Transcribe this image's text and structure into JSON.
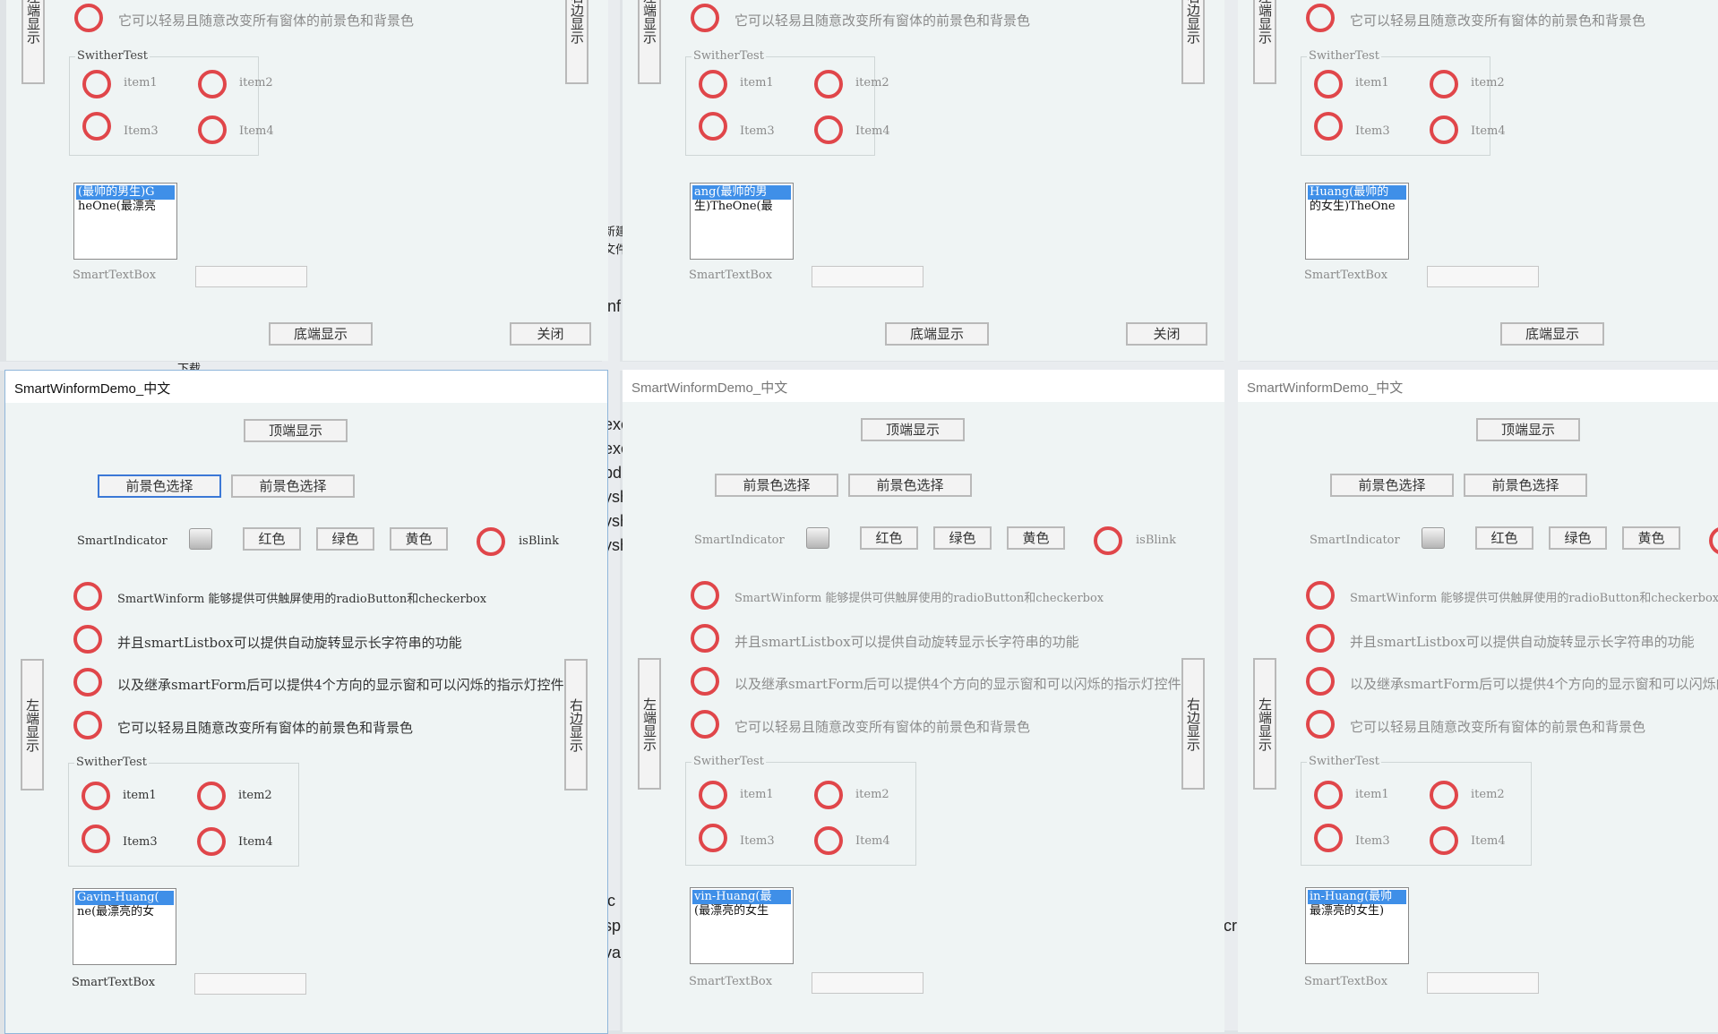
{
  "window": {
    "title": "SmartWinformDemo_中文"
  },
  "buttons": {
    "top": "顶端显示",
    "bottom": "底端显示",
    "close": "关闭",
    "left": "左端显示",
    "right": "右边显示",
    "fore_color_1": "前景色选择",
    "fore_color_2": "前景色选择",
    "red": "红色",
    "green": "绿色",
    "yellow": "黄色"
  },
  "indicator": {
    "label": "SmartIndicator",
    "blink_label": "isBlink"
  },
  "options": [
    "SmartWinform 能够提供可供触屏使用的radioButton和checkerbox",
    "并且smartListbox可以提供自动旋转显示长字符串的功能",
    "以及继承smartForm后可以提供4个方向的显示窗和可以闪烁的指示灯控件",
    "它可以轻易且随意改变所有窗体的前景色和背景色"
  ],
  "switcher": {
    "title": "SwitherTest",
    "items": [
      "item1",
      "item2",
      "Item3",
      "Item4"
    ]
  },
  "textbox": {
    "label": "SmartTextBox"
  },
  "listboxes": {
    "top_left": [
      "(最帅的男生)G",
      "heOne(最漂亮"
    ],
    "top_mid": [
      "ang(最帅的男",
      "生)TheOne(最"
    ],
    "top_right": [
      "Huang(最帅的",
      "的女生)TheOne"
    ],
    "bottom_left": [
      "Gavin-Huang(",
      "ne(最漂亮的女"
    ],
    "bottom_mid": [
      "vin-Huang(最",
      "(最漂亮的女生"
    ],
    "bottom_right": [
      "in-Huang(最帅",
      "最漂亮的女生)"
    ]
  },
  "background_fragments": [
    "新建",
    "文件",
    "inf",
    "下载",
    "exe",
    "exe",
    "pdb",
    "ysh",
    "ysh",
    "ysh",
    "ic",
    "sp",
    "va",
    "cr"
  ]
}
